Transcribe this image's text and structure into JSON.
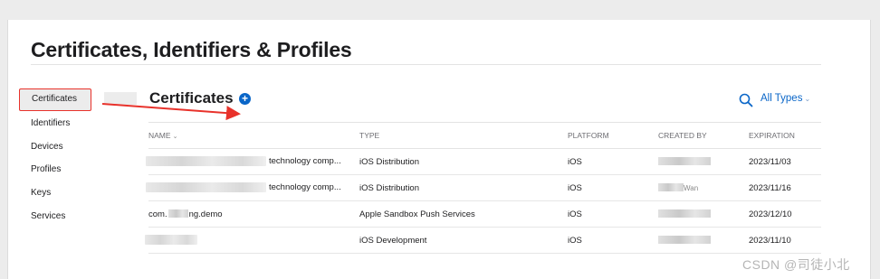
{
  "page": {
    "title": "Certificates, Identifiers & Profiles"
  },
  "sidebar": {
    "items": [
      {
        "label": "Certificates",
        "active": true
      },
      {
        "label": "Identifiers",
        "active": false
      },
      {
        "label": "Devices",
        "active": false
      },
      {
        "label": "Profiles",
        "active": false
      },
      {
        "label": "Keys",
        "active": false
      },
      {
        "label": "Services",
        "active": false
      }
    ]
  },
  "main": {
    "section_title": "Certificates",
    "add_icon": "plus-circle-icon",
    "search_icon": "search-icon",
    "filter_label": "All Types",
    "filter_chevron": "⌄",
    "columns": [
      "NAME",
      "TYPE",
      "PLATFORM",
      "CREATED BY",
      "EXPIRATION"
    ],
    "rows": [
      {
        "name_suffix": "technology comp...",
        "type": "iOS Distribution",
        "platform": "iOS",
        "created_by": "",
        "expiration": "2023/11/03"
      },
      {
        "name_suffix": "technology comp...",
        "type": "iOS Distribution",
        "platform": "iOS",
        "created_by": "Wan",
        "expiration": "2023/11/16"
      },
      {
        "name_prefix": "com.",
        "name_suffix": "ng.demo",
        "type": "Apple Sandbox Push Services",
        "platform": "iOS",
        "created_by": "",
        "expiration": "2023/12/10"
      },
      {
        "name_suffix": "",
        "type": "iOS Development",
        "platform": "iOS",
        "created_by": "",
        "expiration": "2023/11/10"
      }
    ]
  },
  "annotation": {
    "color": "#e8322b"
  },
  "watermark": "CSDN @司徒小北",
  "colors": {
    "accent": "#0a66c8",
    "highlight": "#e8322b"
  }
}
